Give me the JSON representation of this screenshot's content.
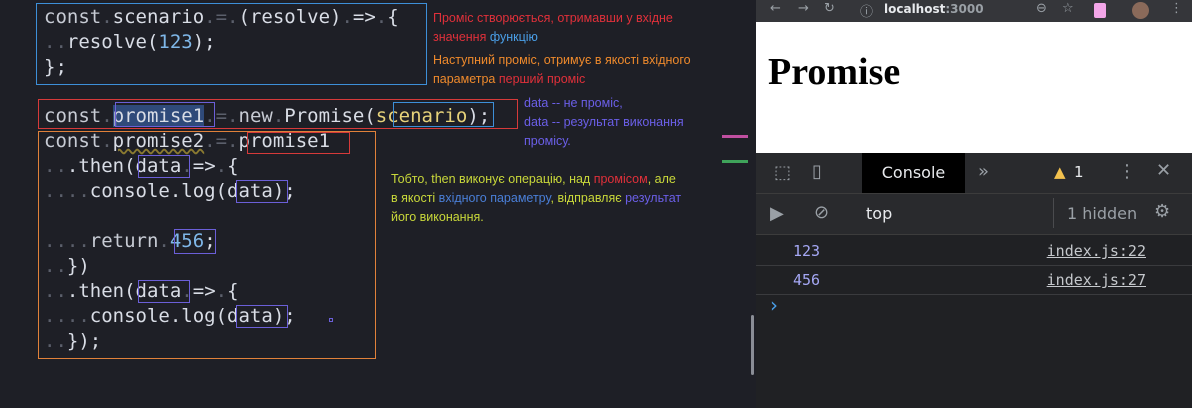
{
  "code": {
    "l1a": "const",
    "l1b": "scenario",
    "l1c": "(resolve)",
    "l1d": "=>",
    "l1e": "{",
    "l2a": "resolve(",
    "l2b": "123",
    "l2c": ");",
    "l3": "};",
    "l5a": "const",
    "l5b": "promise1",
    "l5c": "new",
    "l5d": "Promise(",
    "l5e": "scenario",
    "l5f": ");",
    "l6a": "const",
    "l6b": "promise2",
    "l6c": "promise1",
    "l7a": ".then(",
    "l7b": "data",
    "l7c": "=>",
    "l7d": "{",
    "l8a": "console.log(",
    "l8b": "data",
    "l8c": ");",
    "l10a": "return",
    "l10b": "456",
    "l10c": ";",
    "l11": "})",
    "l12a": ".then(",
    "l12b": "data",
    "l12c": "=>",
    "l12d": "{",
    "l13a": "console.log(",
    "l13b": "data",
    "l13c": ");",
    "l14": "});"
  },
  "annotations": {
    "a1_line1": "Проміс створюється, отримавши у вхідне",
    "a1_line2a": "значення ",
    "a1_line2b": "функцію",
    "a2_line1": "Наступний проміс, отримує в якості вхідного",
    "a2_line2a": "параметра ",
    "a2_line2b": "перший проміс",
    "a3_line1": "data -- не проміс,",
    "a3_line2": "data -- результат виконання",
    "a3_line3": "промісу.",
    "a4_line1a": "Тобто, then виконує операцію, над ",
    "a4_line1b": "промісом",
    "a4_line1c": ", але",
    "a4_line2a": "в якості ",
    "a4_line2b": "вхідного параметру",
    "a4_line2c": ", відправляє ",
    "a4_line2d": "результат",
    "a4_line3": "його виконання."
  },
  "browser": {
    "url_host": "localhost",
    "url_port": ":3000",
    "page_heading": "Promise"
  },
  "devtools": {
    "tab_console": "Console",
    "warning_count": "1",
    "context": "top",
    "hidden": "1 hidden",
    "logs": [
      {
        "value": "123",
        "source": "index.js:22"
      },
      {
        "value": "456",
        "source": "index.js:27"
      }
    ],
    "prompt": "›"
  },
  "colors": {
    "red": "#e0303a",
    "orange": "#ef8a2c",
    "blue": "#4a7fd8",
    "indigo": "#6b5fd8",
    "yellow_green": "#c9d83a",
    "box_blue": "#3d8fd8",
    "box_red": "#d63a3a",
    "box_orange": "#e0813a"
  }
}
